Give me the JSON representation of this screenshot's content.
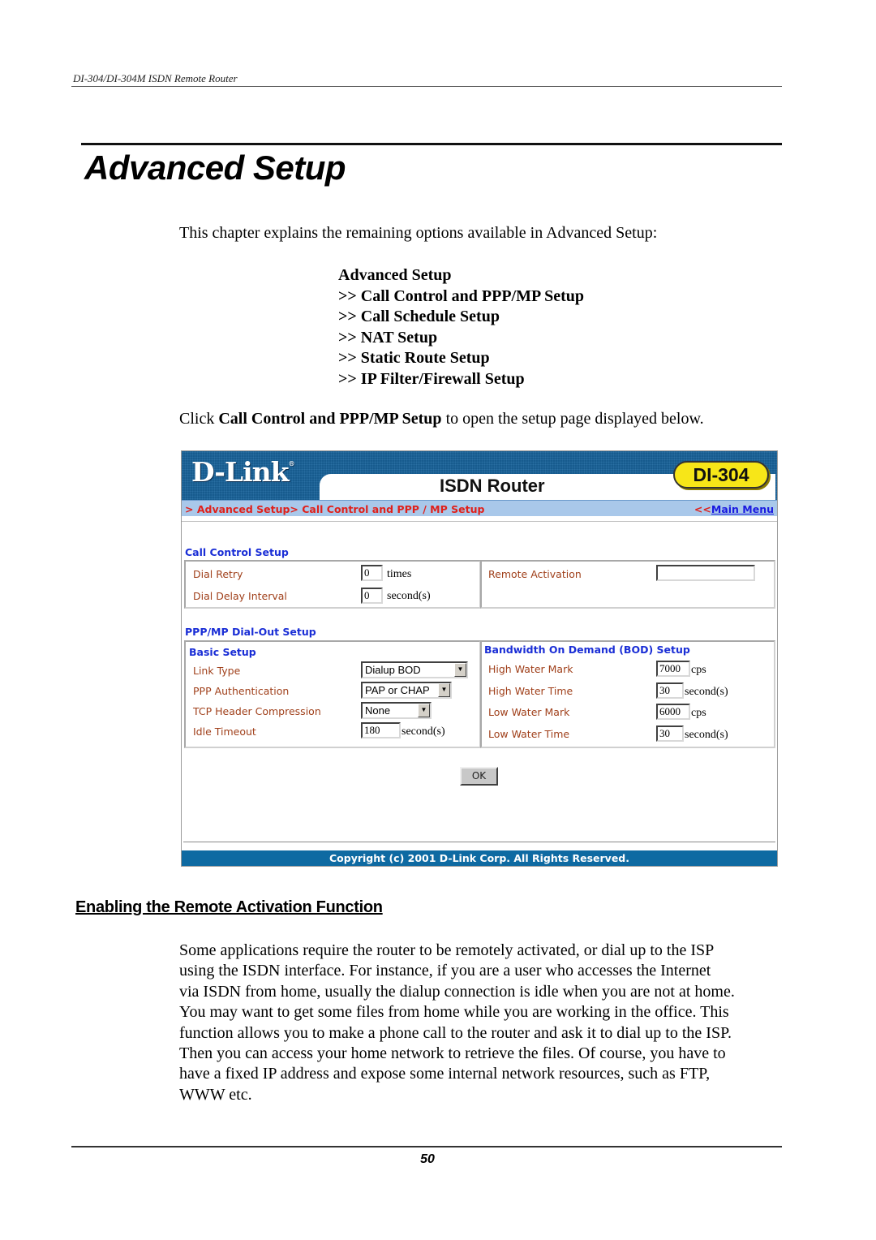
{
  "running_header": "DI-304/DI-304M ISDN Remote Router",
  "chapter_title": "Advanced Setup",
  "intro": "This chapter explains the remaining options available in Advanced Setup:",
  "toc": [
    "Advanced Setup",
    ">> Call Control and PPP/MP Setup",
    ">> Call Schedule Setup",
    ">> NAT Setup",
    ">> Static Route Setup",
    ">> IP Filter/Firewall Setup"
  ],
  "click_line": {
    "prefix": "Click ",
    "bold": "Call Control and PPP/MP Setup",
    "suffix": " to open the setup page displayed below."
  },
  "router_ui": {
    "logo": "D-Link",
    "logo_mark": "®",
    "product": "ISDN Router",
    "model": "DI-304",
    "breadcrumb": "> Advanced Setup> Call Control and PPP / MP Setup",
    "main_menu_arrows": "<<",
    "main_menu_label": "Main Menu",
    "call_control": {
      "heading": "Call Control Setup",
      "dial_retry": {
        "label": "Dial Retry",
        "value": "0",
        "unit": "times"
      },
      "dial_delay": {
        "label": "Dial Delay Interval",
        "value": "0",
        "unit": "second(s)"
      },
      "remote_activation": {
        "label": "Remote Activation",
        "value": ""
      }
    },
    "dialout": {
      "heading": "PPP/MP Dial-Out Setup",
      "basic": {
        "heading": "Basic Setup",
        "link_type": {
          "label": "Link Type",
          "value": "Dialup BOD"
        },
        "ppp_auth": {
          "label": "PPP Authentication",
          "value": "PAP or CHAP"
        },
        "tcp_comp": {
          "label": "TCP Header Compression",
          "value": "None"
        },
        "idle_timeout": {
          "label": "Idle Timeout",
          "value": "180",
          "unit": "second(s)"
        }
      },
      "bod": {
        "heading": "Bandwidth On Demand (BOD) Setup",
        "high_mark": {
          "label": "High Water Mark",
          "value": "7000",
          "unit": "cps"
        },
        "high_time": {
          "label": "High Water Time",
          "value": "30",
          "unit": "second(s)"
        },
        "low_mark": {
          "label": "Low Water Mark",
          "value": "6000",
          "unit": "cps"
        },
        "low_time": {
          "label": "Low Water Time",
          "value": "30",
          "unit": "second(s)"
        }
      }
    },
    "ok_label": "OK",
    "copyright": "Copyright (c) 2001 D-Link Corp. All Rights Reserved.",
    "colors": {
      "banner_blue": "#175b8e",
      "navbar": "#a9c8ea",
      "breadcrumb_red": "#e0201a",
      "section_blue": "#1a2ed6",
      "label_brown": "#a0401b",
      "model_yellow": "#f7e618",
      "footer_blue": "#0e6aa2"
    }
  },
  "section_heading": "Enabling the Remote Activation Function",
  "body_lines": [
    "Some applications require the router to be remotely activated, or dial up to the ISP",
    "using the ISDN interface. For instance, if you are a user who accesses the Internet",
    "via ISDN from home, usually the dialup connection is idle when you are not at home.",
    "You may want to get some files from home while you are working in the office. This",
    "function allows you to make a phone call to the router and ask it to dial up to the ISP.",
    "Then you can access your home network to retrieve the files. Of course, you have to",
    "have a fixed IP address and expose some internal network resources, such as FTP,",
    "WWW etc."
  ],
  "page_number": "50"
}
